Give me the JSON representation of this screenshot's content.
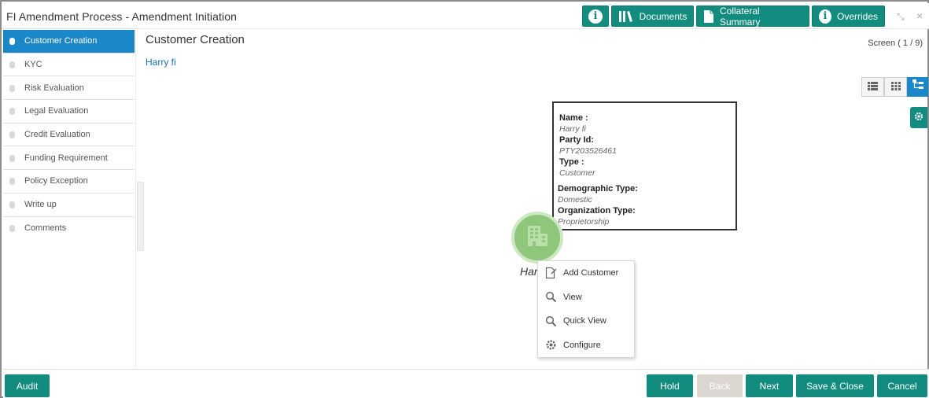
{
  "header": {
    "title": "FI Amendment Process - Amendment Initiation",
    "buttons": {
      "documents": "Documents",
      "collateral_summary": "Collateral Summary",
      "overrides": "Overrides"
    }
  },
  "sidebar": {
    "items": [
      {
        "label": "Customer Creation",
        "active": true
      },
      {
        "label": "KYC"
      },
      {
        "label": "Risk Evaluation"
      },
      {
        "label": "Legal Evaluation"
      },
      {
        "label": "Credit Evaluation"
      },
      {
        "label": "Funding Requirement"
      },
      {
        "label": "Policy Exception"
      },
      {
        "label": "Write up"
      },
      {
        "label": "Comments"
      }
    ]
  },
  "main": {
    "title": "Customer Creation",
    "subtitle": "Harry fi",
    "screen_indicator": "Screen ( 1 / 9)"
  },
  "card": {
    "name_label": "Name :",
    "name_value": "Harry fi",
    "party_label": "Party Id:",
    "party_value": "PTY203526461",
    "type_label": "Type :",
    "type_value": "Customer",
    "demo_label": "Demographic Type:",
    "demo_value": "Domestic",
    "org_label": "Organization Type:",
    "org_value": "Proprietorship"
  },
  "node": {
    "label": "Har",
    "icon": "building-icon"
  },
  "context_menu": {
    "items": [
      {
        "label": "Add Customer",
        "icon": "add-document-icon"
      },
      {
        "label": "View",
        "icon": "search-icon"
      },
      {
        "label": "Quick View",
        "icon": "search-icon"
      },
      {
        "label": "Configure",
        "icon": "gear-icon"
      }
    ]
  },
  "footer": {
    "audit": "Audit",
    "hold": "Hold",
    "back": "Back",
    "next": "Next",
    "save_close": "Save & Close",
    "cancel": "Cancel"
  },
  "colors": {
    "accent": "#128c7e",
    "active_nav": "#1a87c9",
    "node": "#8ec77c"
  }
}
